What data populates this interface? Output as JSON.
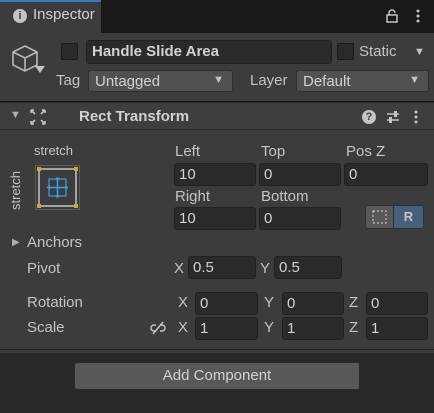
{
  "window": {
    "tab_label": "Inspector",
    "tab_icon": "info-icon"
  },
  "header": {
    "object_name": "Handle Slide Area",
    "active": false,
    "static_label": "Static",
    "static": false,
    "tag_label": "Tag",
    "tag_value": "Untagged",
    "layer_label": "Layer",
    "layer_value": "Default"
  },
  "component": {
    "title": "Rect Transform",
    "expanded": true,
    "anchor_preset": {
      "horizontal": "stretch",
      "vertical": "stretch"
    },
    "fields": {
      "left": {
        "label": "Left",
        "value": "10"
      },
      "top": {
        "label": "Top",
        "value": "0"
      },
      "posz": {
        "label": "Pos Z",
        "value": "0"
      },
      "right": {
        "label": "Right",
        "value": "10"
      },
      "bottom": {
        "label": "Bottom",
        "value": "0"
      }
    },
    "raw_button_label": "R",
    "anchors_label": "Anchors",
    "pivot": {
      "label": "Pivot",
      "x_label": "X",
      "x": "0.5",
      "y_label": "Y",
      "y": "0.5"
    },
    "rotation": {
      "label": "Rotation",
      "x_label": "X",
      "x": "0",
      "y_label": "Y",
      "y": "0",
      "z_label": "Z",
      "z": "0"
    },
    "scale": {
      "label": "Scale",
      "x_label": "X",
      "x": "1",
      "y_label": "Y",
      "y": "1",
      "z_label": "Z",
      "z": "1"
    }
  },
  "footer": {
    "add_component_label": "Add Component"
  },
  "colors": {
    "accent": "#3a79bb",
    "panel": "#3c3c3c",
    "field": "#2a2a2a",
    "selected_button": "#46607c"
  }
}
